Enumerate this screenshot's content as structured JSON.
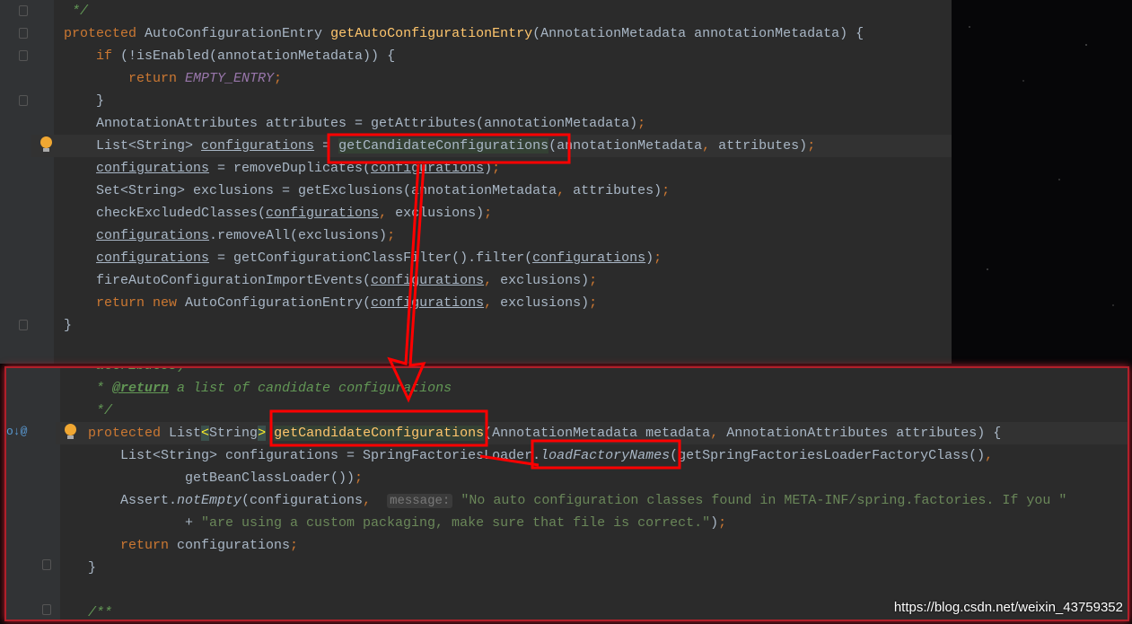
{
  "top_code": [
    {
      "indent": 1,
      "tokens": [
        [
          "*/",
          "cm"
        ]
      ]
    },
    {
      "indent": 0,
      "tokens": [
        [
          "protected ",
          "kw"
        ],
        [
          "AutoConfigurationEntry ",
          ""
        ],
        [
          "getAutoConfigurationEntry",
          "fn"
        ],
        [
          "(AnnotationMetadata annotationMetadata) {",
          ""
        ]
      ]
    },
    {
      "indent": 4,
      "tokens": [
        [
          "if ",
          "kw"
        ],
        [
          "(!isEnabled(annotationMetadata)) {",
          ""
        ]
      ]
    },
    {
      "indent": 8,
      "tokens": [
        [
          "return ",
          "kw"
        ],
        [
          "EMPTY_ENTRY",
          "fld"
        ],
        [
          ";",
          "kw"
        ]
      ]
    },
    {
      "indent": 4,
      "tokens": [
        [
          "}",
          ""
        ]
      ]
    },
    {
      "indent": 4,
      "tokens": [
        [
          "AnnotationAttributes attributes = getAttributes(annotationMetadata)",
          ""
        ],
        [
          ";",
          "kw"
        ]
      ]
    },
    {
      "indent": 4,
      "current": true,
      "tokens": [
        [
          "List<String> ",
          ""
        ],
        [
          "configurations",
          "ul"
        ],
        [
          " = ",
          ""
        ],
        [
          "getCandidateConfigurations",
          "hl"
        ],
        [
          "(annotationMetadata",
          ""
        ],
        [
          ", ",
          "kw"
        ],
        [
          "attributes)",
          ""
        ],
        [
          ";",
          "kw"
        ]
      ]
    },
    {
      "indent": 4,
      "tokens": [
        [
          "configurations",
          "ul"
        ],
        [
          " = removeDuplicates(",
          ""
        ],
        [
          "configurations",
          "ul"
        ],
        [
          ")",
          ""
        ],
        [
          ";",
          "kw"
        ]
      ]
    },
    {
      "indent": 4,
      "tokens": [
        [
          "Set<String> exclusions = getExclusions(annotationMetadata",
          ""
        ],
        [
          ", ",
          "kw"
        ],
        [
          "attributes)",
          ""
        ],
        [
          ";",
          "kw"
        ]
      ]
    },
    {
      "indent": 4,
      "tokens": [
        [
          "checkExcludedClasses(",
          ""
        ],
        [
          "configurations",
          "ul"
        ],
        [
          ", ",
          "kw"
        ],
        [
          "exclusions)",
          ""
        ],
        [
          ";",
          "kw"
        ]
      ]
    },
    {
      "indent": 4,
      "tokens": [
        [
          "configurations",
          "ul"
        ],
        [
          ".removeAll(exclusions)",
          ""
        ],
        [
          ";",
          "kw"
        ]
      ]
    },
    {
      "indent": 4,
      "tokens": [
        [
          "configurations",
          "ul"
        ],
        [
          " = getConfigurationClassFilter().filter(",
          ""
        ],
        [
          "configurations",
          "ul"
        ],
        [
          ")",
          ""
        ],
        [
          ";",
          "kw"
        ]
      ]
    },
    {
      "indent": 4,
      "tokens": [
        [
          "fireAutoConfigurationImportEvents(",
          ""
        ],
        [
          "configurations",
          "ul"
        ],
        [
          ", ",
          "kw"
        ],
        [
          "exclusions)",
          ""
        ],
        [
          ";",
          "kw"
        ]
      ]
    },
    {
      "indent": 4,
      "tokens": [
        [
          "return new ",
          "kw"
        ],
        [
          "AutoConfigurationEntry(",
          ""
        ],
        [
          "configurations",
          "ul"
        ],
        [
          ", ",
          "kw"
        ],
        [
          "exclusions)",
          ""
        ],
        [
          ";",
          "kw"
        ]
      ]
    },
    {
      "indent": 0,
      "tokens": [
        [
          "}",
          ""
        ]
      ]
    }
  ],
  "bottom_code": [
    {
      "indent": 1,
      "tokens": [
        [
          "attributes)",
          "cm"
        ]
      ]
    },
    {
      "indent": 1,
      "tokens": [
        [
          "* ",
          "cm"
        ],
        [
          "@return",
          "doc"
        ],
        [
          " a list of candidate configurations",
          "cm"
        ]
      ]
    },
    {
      "indent": 1,
      "tokens": [
        [
          "*/",
          "cm"
        ]
      ]
    },
    {
      "indent": 0,
      "current": true,
      "tokens": [
        [
          "protected ",
          "kw"
        ],
        [
          "List",
          ""
        ],
        [
          "<",
          "br"
        ],
        [
          "String",
          ""
        ],
        [
          ">",
          "br"
        ],
        [
          " ",
          ""
        ],
        [
          "getCandidateConfigurations",
          "fn hl"
        ],
        [
          "(AnnotationMetadata metadata",
          ""
        ],
        [
          ", ",
          "kw"
        ],
        [
          "AnnotationAttributes attributes) {",
          ""
        ]
      ]
    },
    {
      "indent": 4,
      "tokens": [
        [
          "List<String> configurations = SpringFactoriesLoader.",
          ""
        ],
        [
          "loadFactoryNames",
          "it"
        ],
        [
          "(getSpringFactoriesLoaderFactoryClass()",
          ""
        ],
        [
          ",",
          "kw"
        ]
      ]
    },
    {
      "indent": 12,
      "tokens": [
        [
          "getBeanClassLoader())",
          ""
        ],
        [
          ";",
          "kw"
        ]
      ]
    },
    {
      "indent": 4,
      "tokens": [
        [
          "Assert.",
          ""
        ],
        [
          "notEmpty",
          "it"
        ],
        [
          "(configurations",
          ""
        ],
        [
          ",  ",
          "kw"
        ],
        [
          "message:",
          "hint"
        ],
        [
          " ",
          ""
        ],
        [
          "\"No auto configuration classes found in META-INF/spring.factories. If you \"",
          "str"
        ]
      ]
    },
    {
      "indent": 12,
      "tokens": [
        [
          "+ ",
          ""
        ],
        [
          "\"are using a custom packaging, make sure that file is correct.\"",
          "str"
        ],
        [
          ")",
          ""
        ],
        [
          ";",
          "kw"
        ]
      ]
    },
    {
      "indent": 4,
      "tokens": [
        [
          "return ",
          "kw"
        ],
        [
          "configurations",
          ""
        ],
        [
          ";",
          "kw"
        ]
      ]
    },
    {
      "indent": 0,
      "tokens": [
        [
          "}",
          ""
        ]
      ]
    },
    {
      "indent": 0,
      "tokens": [
        [
          "",
          ""
        ]
      ]
    },
    {
      "indent": 0,
      "tokens": [
        [
          "/**",
          "cm"
        ]
      ]
    }
  ],
  "annotation_color": "#ff0000",
  "watermark": "https://blog.csdn.net/weixin_43759352"
}
